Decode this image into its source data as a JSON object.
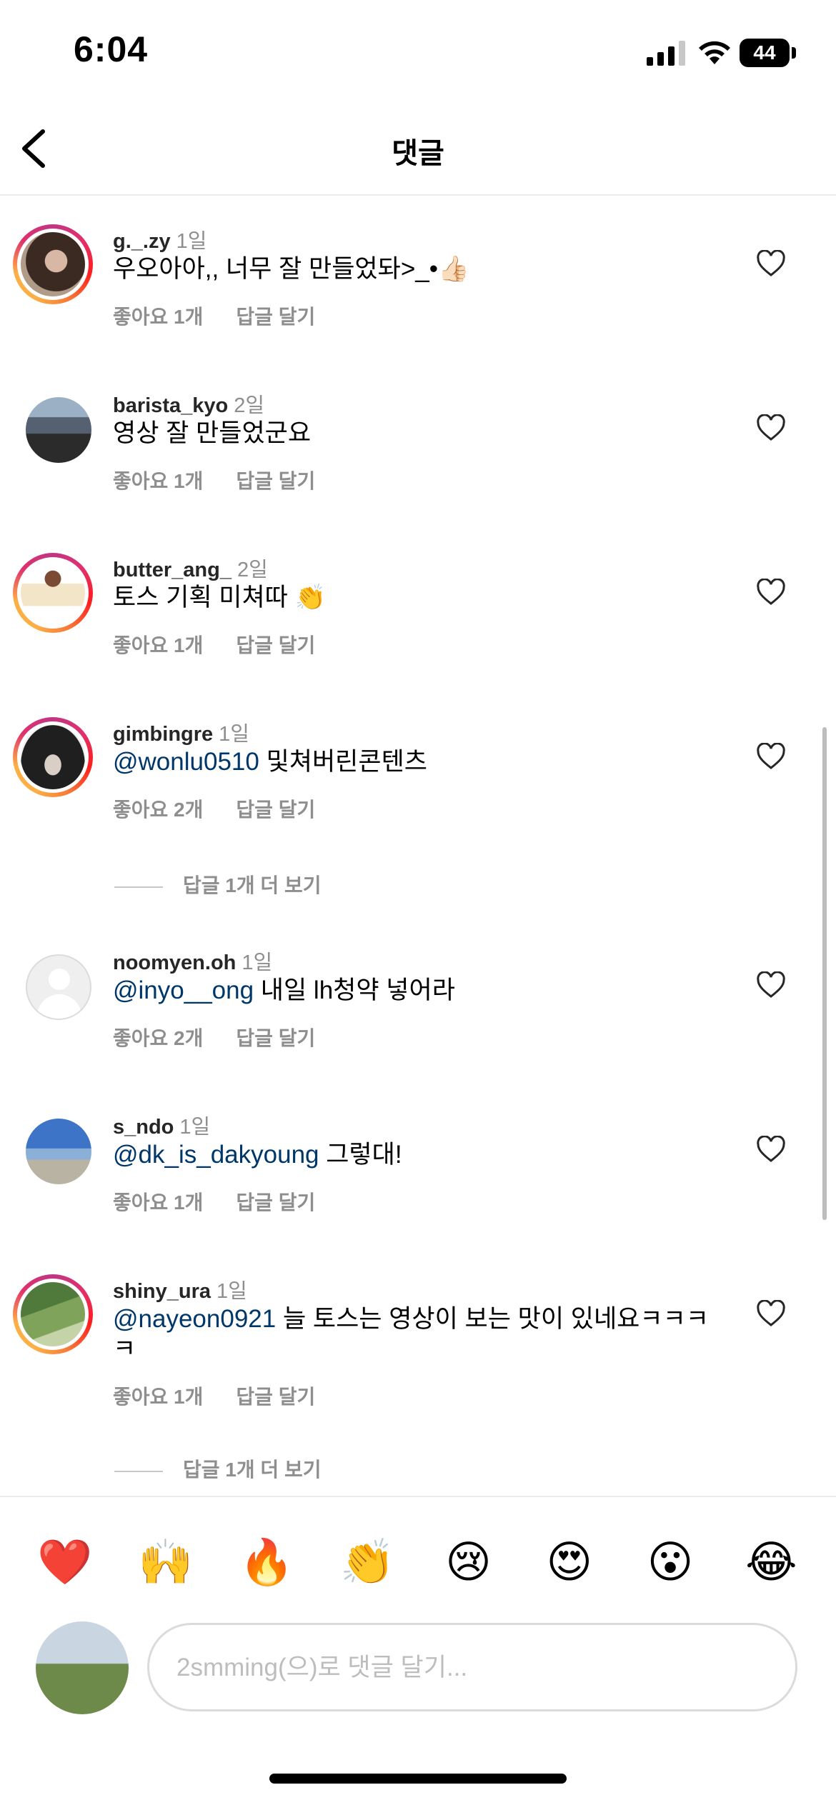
{
  "status_bar": {
    "time": "6:04",
    "battery": "44"
  },
  "header": {
    "title": "댓글"
  },
  "comments": [
    {
      "username": "g._.zy",
      "time": "1일",
      "text": "우오아아,, 너무 잘 만들었돠>_•👍🏻",
      "likes": "좋아요 1개",
      "reply": "답글 달기"
    },
    {
      "username": "barista_kyo",
      "time": "2일",
      "text": "영상 잘 만들었군요",
      "likes": "좋아요 1개",
      "reply": "답글 달기"
    },
    {
      "username": "butter_ang_",
      "time": "2일",
      "text": "토스 기획 미쳐따 👏",
      "likes": "좋아요 1개",
      "reply": "답글 달기"
    },
    {
      "username": "gimbingre",
      "time": "1일",
      "mention": "@wonlu0510",
      "text": " 및쳐버린콘텐츠",
      "likes": "좋아요 2개",
      "reply": "답글 달기",
      "more_replies": "답글 1개 더 보기"
    },
    {
      "username": "noomyen.oh",
      "time": "1일",
      "mention": "@inyo__ong",
      "text": " 내일 lh청약 넣어라",
      "likes": "좋아요 2개",
      "reply": "답글 달기"
    },
    {
      "username": "s_ndo",
      "time": "1일",
      "mention": "@dk_is_dakyoung",
      "text": " 그렇대!",
      "likes": "좋아요 1개",
      "reply": "답글 달기"
    },
    {
      "username": "shiny_ura",
      "time": "1일",
      "mention": "@nayeon0921",
      "text": " 늘 토스는 영상이 보는 맛이 있네요ㅋㅋㅋㅋ",
      "likes": "좋아요 1개",
      "reply": "답글 달기",
      "more_replies": "답글 1개 더 보기"
    }
  ],
  "emoji_bar": [
    "❤️",
    "🙌",
    "🔥",
    "👏",
    "😢",
    "😍",
    "😮",
    "😂"
  ],
  "composer": {
    "placeholder": "2smming(으)로 댓글 달기..."
  },
  "colors": {
    "mention": "#00376b",
    "secondary_text": "#8e8e8e"
  }
}
